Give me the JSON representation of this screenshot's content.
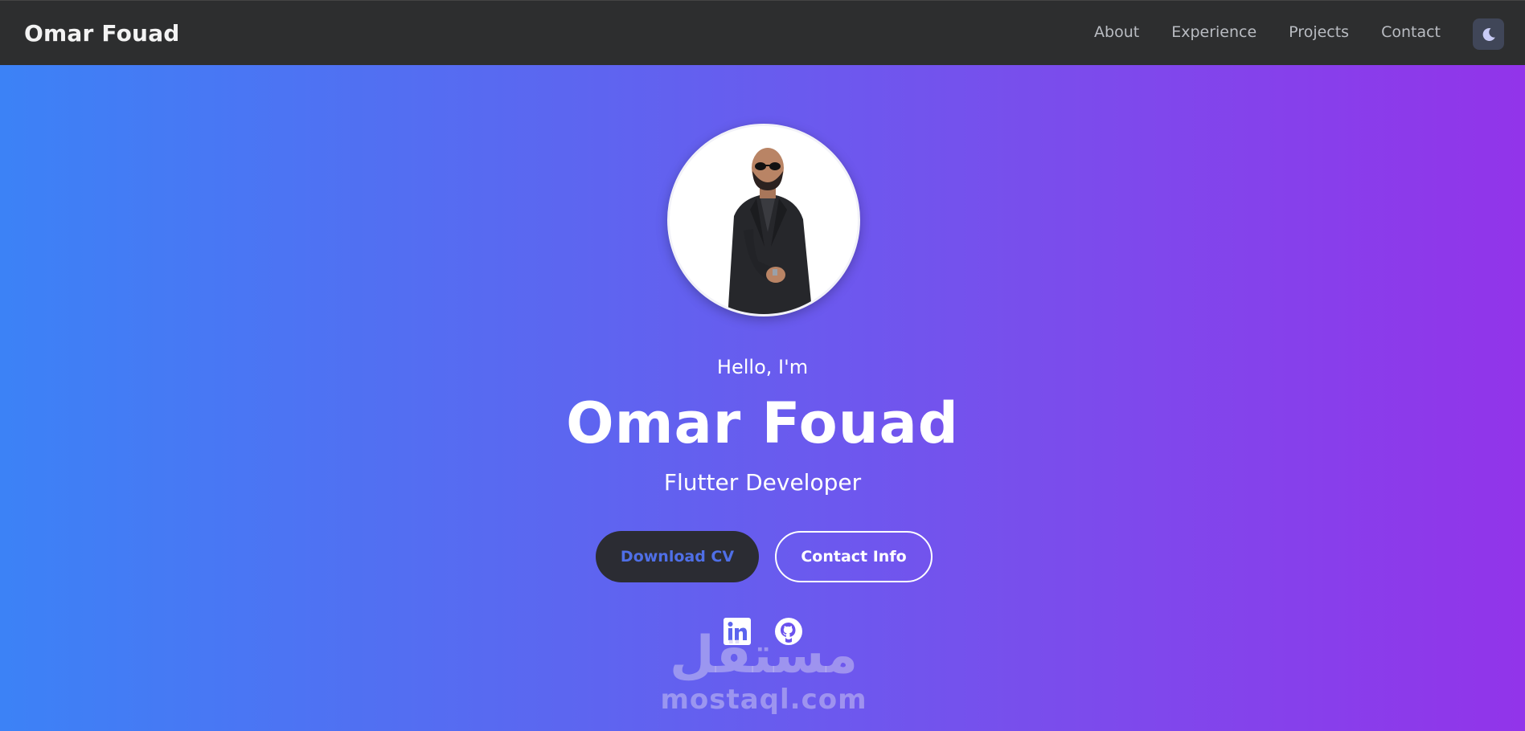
{
  "header": {
    "brand": "Omar Fouad",
    "nav": [
      {
        "label": "About"
      },
      {
        "label": "Experience"
      },
      {
        "label": "Projects"
      },
      {
        "label": "Contact"
      }
    ],
    "theme_toggle_icon": "moon-icon"
  },
  "hero": {
    "greeting": "Hello, I'm",
    "name": "Omar Fouad",
    "role": "Flutter Developer",
    "download_cv_label": "Download CV",
    "contact_info_label": "Contact Info",
    "social": [
      {
        "icon": "linkedin-icon"
      },
      {
        "icon": "github-icon"
      }
    ]
  },
  "watermark": {
    "arabic": "مستقل",
    "latin": "mostaql.com"
  },
  "colors": {
    "navbar_bg": "#2d2e2f",
    "gradient_start": "#3c82f6",
    "gradient_end": "#9234ea",
    "cv_button_bg": "#2b2c33",
    "cv_button_text": "#4f6fe7"
  }
}
